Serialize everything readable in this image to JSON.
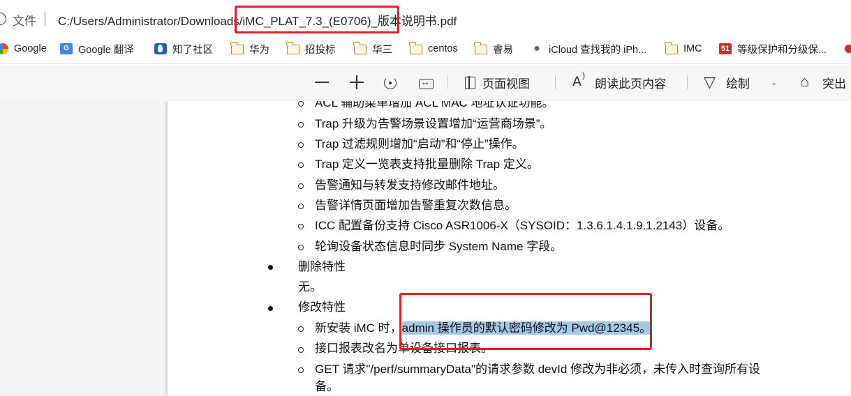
{
  "address_bar": {
    "label": "文件",
    "url": "C:/Users/Administrator/Downloads/iMC_PLAT_7.3_(E0706)_版本说明书.pdf"
  },
  "bookmarks": [
    {
      "label": "Google",
      "icon": "google-icon"
    },
    {
      "label": "Google 翻译",
      "icon": "google-translate-icon"
    },
    {
      "label": "知了社区",
      "icon": "zhiliao-icon"
    },
    {
      "label": "华为",
      "icon": "folder-icon"
    },
    {
      "label": "招投标",
      "icon": "folder-icon"
    },
    {
      "label": "华三",
      "icon": "folder-icon"
    },
    {
      "label": "centos",
      "icon": "folder-icon"
    },
    {
      "label": "睿易",
      "icon": "folder-icon"
    },
    {
      "label": "iCloud 查找我的 iPh...",
      "icon": "apple-icon"
    },
    {
      "label": "IMC",
      "icon": "folder-icon"
    },
    {
      "label": "等级保护和分级保...",
      "icon": "site-51-icon"
    }
  ],
  "pdf_toolbar": {
    "page_view": "页面视图",
    "read_aloud": "朗读此页内容",
    "draw": "绘制",
    "highlight": "突出"
  },
  "document": {
    "sub_items_1": [
      "ACL 辅助菜单增加 ACL MAC 地址认证功能。",
      "Trap 升级为告警场景设置增加“运营商场景”。",
      "Trap 过滤规则增加“启动”和“停止”操作。",
      "Trap 定义一览表支持批量删除 Trap 定义。",
      "告警通知与转发支持修改邮件地址。",
      "告警详情页面增加告警重复次数信息。",
      "ICC 配置备份支持 Cisco  ASR1006-X（SYSOID：1.3.6.1.4.1.9.1.2143）设备。",
      "轮询设备状态信息时同步 System Name 字段。"
    ],
    "section_delete": {
      "title": "删除特性",
      "body": "无。"
    },
    "section_modify": {
      "title": "修改特性"
    },
    "modify_item_1": {
      "prefix": "新安装 iMC 时，",
      "highlight": "admin 操作员的默认密码修改为 Pwd@12345。"
    },
    "modify_item_2": "接口报表改名为单设备接口报表。",
    "modify_item_3_line1": "GET 请求\"/perf/summaryData\"的请求参数 devId 修改为非必须，未传入时查询所有设",
    "modify_item_3_line2": "备。"
  },
  "colors": {
    "annotation_red": "#e02020",
    "text_highlight": "#a6c8e6"
  }
}
